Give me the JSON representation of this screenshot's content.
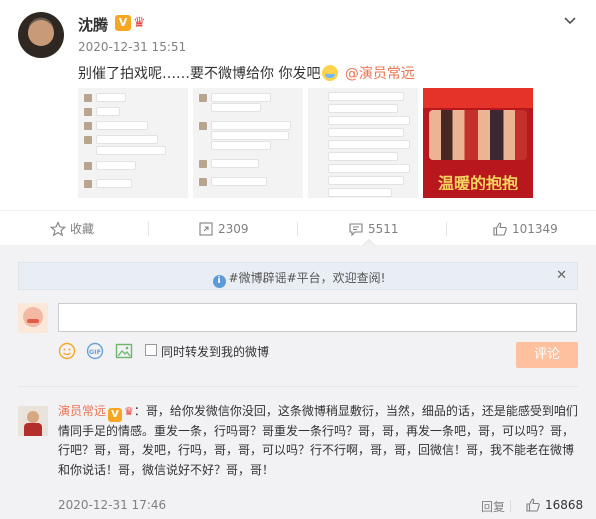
{
  "post": {
    "author": "沈腾",
    "timestamp": "2020-12-31 15:51",
    "text_before": "别催了拍戏呢……要不微博给你 你发吧",
    "mention": "@演员常远",
    "thumbnail_title": "温暖的抱抱"
  },
  "actions": {
    "favorite": "收藏",
    "repost_count": "2309",
    "comment_count": "5511",
    "like_count": "101349"
  },
  "comment_box": {
    "notice": "#微博辟谣#平台，欢迎查阅!",
    "input_value": "",
    "repost_label": "同时转发到我的微博",
    "submit": "评论"
  },
  "comment": {
    "author": "演员常远",
    "text": "：哥，给你发微信你没回，这条微博稍显敷衍，当然，细品的话，还是能感受到咱们情同手足的情感。重发一条，行吗哥？哥重发一条行吗？哥，哥，再发一条吧，哥，可以吗？哥，行吧？哥，哥，发吧，行吗，哥，哥，可以吗？行不行啊，哥，哥，回微信！哥，我不能老在微博和你说话！哥，微信说好不好？哥，哥！",
    "timestamp": "2020-12-31 17:46",
    "reply": "回复",
    "likes": "16868"
  },
  "colors": {
    "accent": "#eb7350",
    "verified": "#f5a623",
    "submit_disabled": "#ffc09f",
    "comment_bg": "#f2f2f5"
  },
  "icons": [
    "chevron-down-icon",
    "star-icon",
    "repost-icon",
    "comment-icon",
    "thumbs-up-icon",
    "info-icon",
    "close-icon",
    "emoji-icon",
    "gif-icon",
    "image-icon"
  ]
}
